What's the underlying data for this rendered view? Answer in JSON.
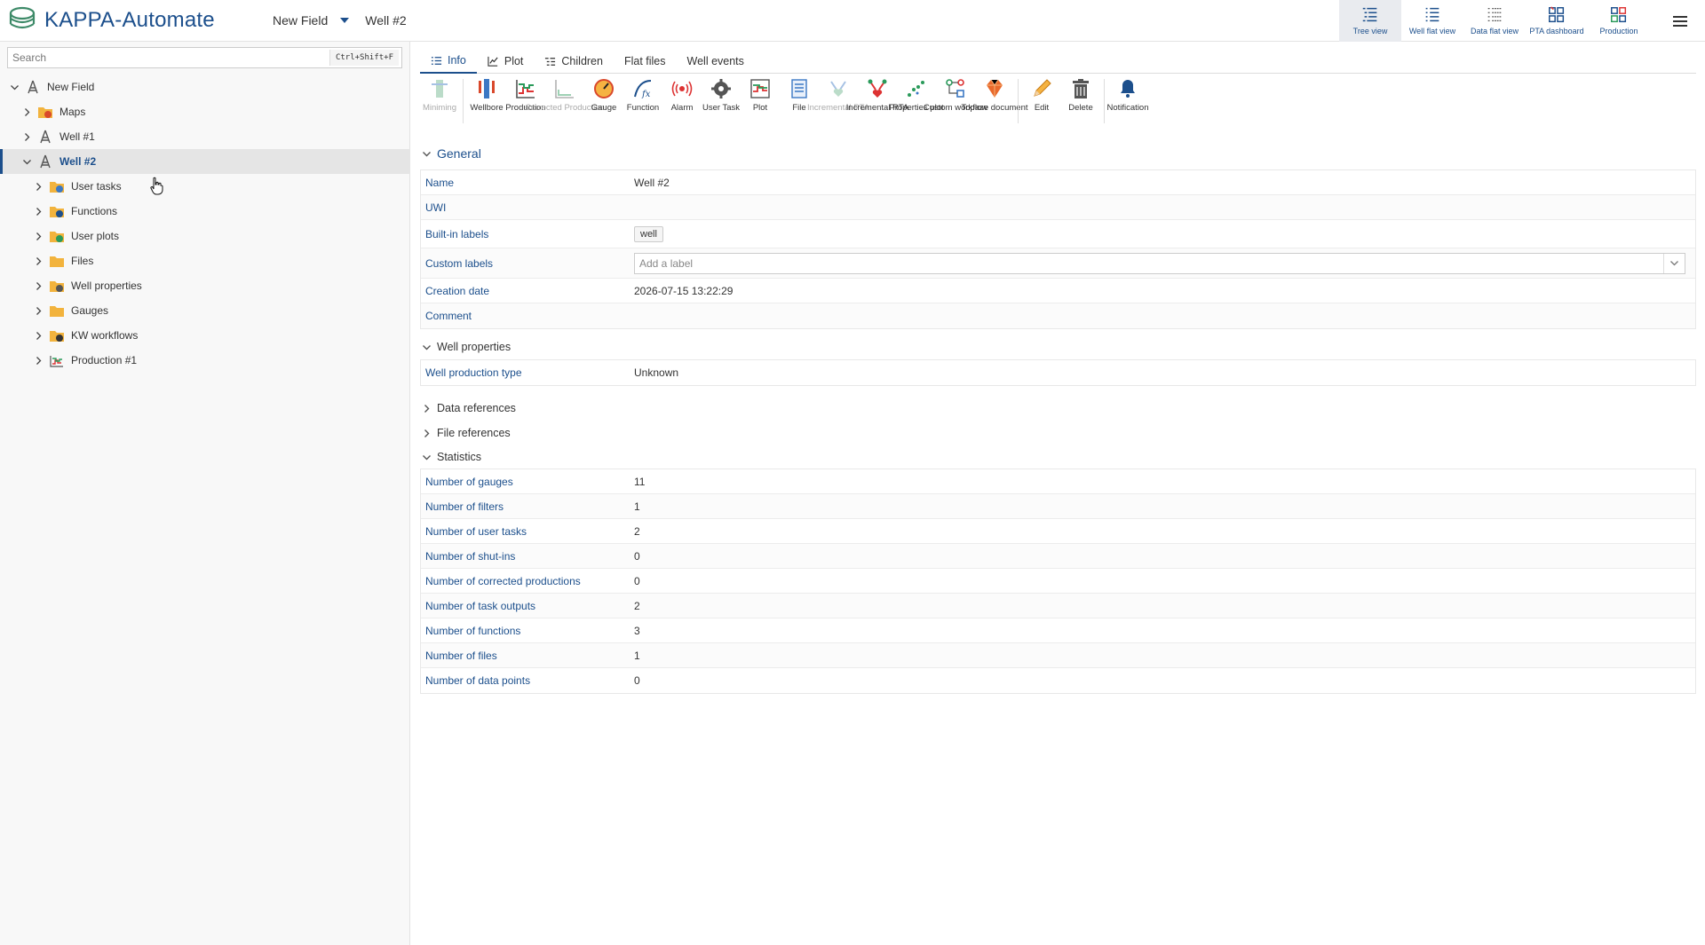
{
  "app": {
    "title": "KAPPA-Automate",
    "brand_color": "#1c4f8c"
  },
  "breadcrumb": {
    "field": "New Field",
    "well": "Well #2"
  },
  "views": [
    {
      "label": "Tree view",
      "icon": "tree-view-icon",
      "active": true
    },
    {
      "label": "Well flat view",
      "icon": "well-flat-view-icon",
      "active": false
    },
    {
      "label": "Data flat view",
      "icon": "data-flat-view-icon",
      "active": false
    },
    {
      "label": "PTA dashboard",
      "icon": "pta-dashboard-icon",
      "active": false
    },
    {
      "label": "Production",
      "icon": "production-dashboard-icon",
      "active": false
    }
  ],
  "search": {
    "placeholder": "Search",
    "shortcut": "Ctrl+Shift+F"
  },
  "tree": [
    {
      "label": "New Field",
      "icon": "field-icon",
      "expanded": true,
      "level": 0
    },
    {
      "label": "Maps",
      "icon": "maps-folder-icon",
      "expanded": false,
      "level": 1
    },
    {
      "label": "Well #1",
      "icon": "well-icon",
      "expanded": false,
      "level": 1
    },
    {
      "label": "Well #2",
      "icon": "well-icon",
      "expanded": true,
      "level": 1,
      "selected": true
    },
    {
      "label": "User tasks",
      "icon": "user-tasks-folder-icon",
      "expanded": false,
      "level": 2
    },
    {
      "label": "Functions",
      "icon": "functions-folder-icon",
      "expanded": false,
      "level": 2
    },
    {
      "label": "User plots",
      "icon": "user-plots-folder-icon",
      "expanded": false,
      "level": 2
    },
    {
      "label": "Files",
      "icon": "files-folder-icon",
      "expanded": false,
      "level": 2
    },
    {
      "label": "Well properties",
      "icon": "well-properties-folder-icon",
      "expanded": false,
      "level": 2
    },
    {
      "label": "Gauges",
      "icon": "gauges-folder-icon",
      "expanded": false,
      "level": 2
    },
    {
      "label": "KW workflows",
      "icon": "kw-workflows-folder-icon",
      "expanded": false,
      "level": 2
    },
    {
      "label": "Production #1",
      "icon": "production-icon",
      "expanded": false,
      "level": 2
    }
  ],
  "tabs": [
    {
      "label": "Info",
      "icon": "list-icon",
      "active": true
    },
    {
      "label": "Plot",
      "icon": "plot-icon",
      "active": false
    },
    {
      "label": "Children",
      "icon": "children-icon",
      "active": false
    },
    {
      "label": "Flat files",
      "icon": "",
      "active": false
    },
    {
      "label": "Well events",
      "icon": "",
      "active": false
    }
  ],
  "toolbar": [
    {
      "label": "Miniming",
      "icon": "minimizing-icon",
      "disabled": true
    },
    {
      "sep": true
    },
    {
      "label": "Wellbore",
      "icon": "wellbore-icon",
      "disabled": false
    },
    {
      "label": "Production",
      "icon": "production-icon",
      "disabled": false
    },
    {
      "label": "Corrected Production",
      "icon": "corrected-production-icon",
      "disabled": true
    },
    {
      "label": "Gauge",
      "icon": "gauge-icon",
      "disabled": false
    },
    {
      "label": "Function",
      "icon": "function-icon",
      "disabled": false
    },
    {
      "label": "Alarm",
      "icon": "alarm-icon",
      "disabled": false
    },
    {
      "label": "User Task",
      "icon": "user-task-icon",
      "disabled": false
    },
    {
      "label": "Plot",
      "icon": "plot-icon",
      "disabled": false
    },
    {
      "label": "File",
      "icon": "file-icon",
      "disabled": false
    },
    {
      "label": "Incremental PTA",
      "icon": "incremental-pta-icon",
      "disabled": true
    },
    {
      "label": "Incremental RTA",
      "icon": "incremental-rta-icon",
      "disabled": false
    },
    {
      "label": "Properties plot",
      "icon": "properties-plot-icon",
      "disabled": false
    },
    {
      "label": "Custom workflow",
      "icon": "custom-workflow-icon",
      "disabled": false
    },
    {
      "label": "Topaze document",
      "icon": "topaze-document-icon",
      "disabled": false
    },
    {
      "sep": true
    },
    {
      "label": "Edit",
      "icon": "edit-icon",
      "disabled": false
    },
    {
      "label": "Delete",
      "icon": "delete-icon",
      "disabled": false
    },
    {
      "sep": true
    },
    {
      "label": "Notification",
      "icon": "notification-icon",
      "disabled": false
    }
  ],
  "general": {
    "title": "General",
    "name_label": "Name",
    "name_value": "Well #2",
    "uwi_label": "UWI",
    "uwi_value": "",
    "builtin_label": "Built-in labels",
    "builtin_chip": "well",
    "custom_label": "Custom labels",
    "custom_placeholder": "Add a label",
    "creation_label": "Creation date",
    "creation_value": "2026-07-15 13:22:29",
    "comment_label": "Comment",
    "comment_value": ""
  },
  "well_properties": {
    "title": "Well properties",
    "rows": [
      {
        "key": "Well production type",
        "value": "Unknown"
      }
    ]
  },
  "data_references": {
    "title": "Data references"
  },
  "file_references": {
    "title": "File references"
  },
  "statistics": {
    "title": "Statistics",
    "rows": [
      {
        "key": "Number of gauges",
        "value": "11"
      },
      {
        "key": "Number of filters",
        "value": "1"
      },
      {
        "key": "Number of user tasks",
        "value": "2"
      },
      {
        "key": "Number of shut-ins",
        "value": "0"
      },
      {
        "key": "Number of corrected productions",
        "value": "0"
      },
      {
        "key": "Number of task outputs",
        "value": "2"
      },
      {
        "key": "Number of functions",
        "value": "3"
      },
      {
        "key": "Number of files",
        "value": "1"
      },
      {
        "key": "Number of data points",
        "value": "0"
      }
    ]
  }
}
